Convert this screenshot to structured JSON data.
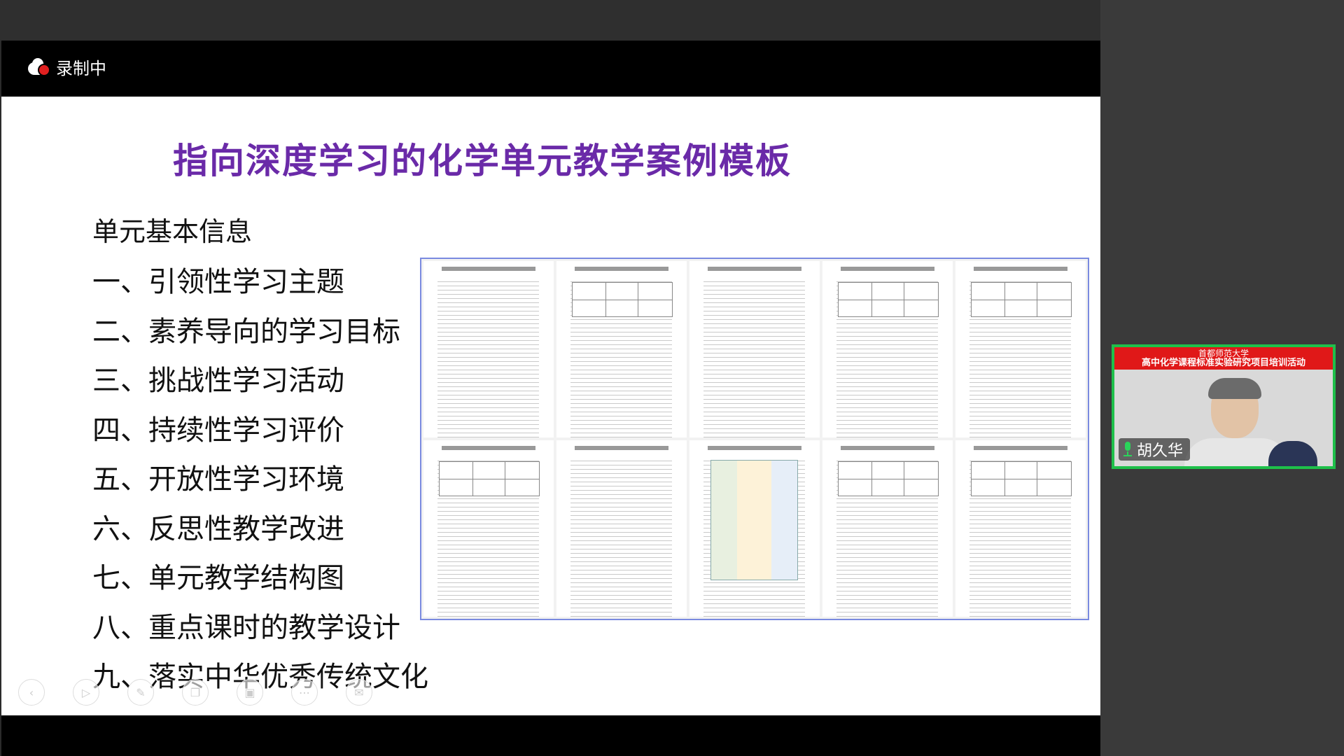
{
  "recording": {
    "label": "录制中",
    "icon": "cloud-record-icon"
  },
  "slide": {
    "title": "指向深度学习的化学单元教学案例模板",
    "heading": "单元基本信息",
    "outline": [
      "一、引领性学习主题",
      "二、素养导向的学习目标",
      "三、挑战性学习活动",
      "四、持续性学习评价",
      "五、开放性学习环境",
      "六、反思性教学改进",
      "七、单元教学结构图",
      "八、重点课时的教学设计",
      "九、落实中华优秀传统文化"
    ],
    "thumbnail_count": 10
  },
  "controls": [
    "prev-icon",
    "play-icon",
    "pen-icon",
    "copy-icon",
    "screen-icon",
    "more-icon",
    "chat-icon"
  ],
  "participant": {
    "name": "胡久华",
    "banner_line1": "首都师范大学",
    "banner_line2": "高中化学课程标准实验研究项目培训活动",
    "mic_icon": "microphone-icon",
    "highlight_color": "#1ec04a"
  },
  "colors": {
    "title": "#6a2aa8",
    "recording_dot": "#e02020",
    "banner": "#e01818"
  }
}
